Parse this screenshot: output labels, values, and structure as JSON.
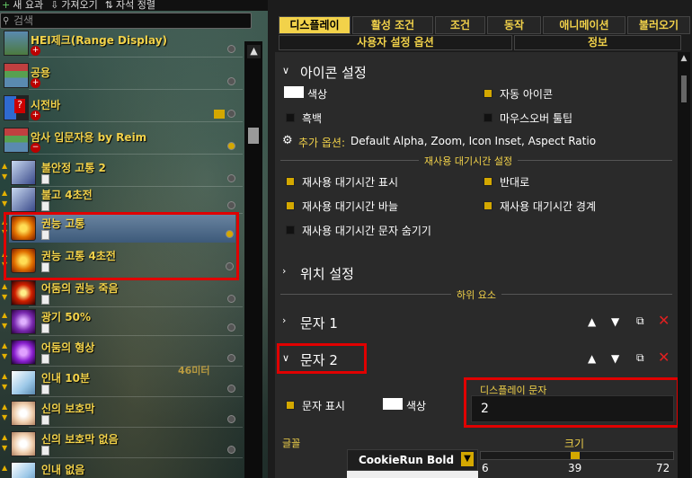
{
  "toolbar": {
    "new_label": "새 요과",
    "import_label": "가져오기",
    "sort_label": "자석 정렬"
  },
  "search": {
    "placeholder": "검색"
  },
  "list": [
    {
      "name": "HEI제크(Range Display)",
      "kind": "group"
    },
    {
      "name": "공용",
      "kind": "group"
    },
    {
      "name": "시전바",
      "kind": "group"
    },
    {
      "name": "암사 입문자용 by Reim",
      "kind": "group"
    },
    {
      "name": "불안정 고통 2",
      "kind": "aura"
    },
    {
      "name": "불고 4초전",
      "kind": "aura"
    },
    {
      "name": "권능 고통",
      "kind": "aura"
    },
    {
      "name": "권능 고통 4초전",
      "kind": "aura"
    },
    {
      "name": "어둠의 권능 죽음",
      "kind": "aura"
    },
    {
      "name": "광기 50%",
      "kind": "aura"
    },
    {
      "name": "어둠의 형상",
      "kind": "aura"
    },
    {
      "name": "인내 10분",
      "kind": "aura"
    },
    {
      "name": "신의 보호막",
      "kind": "aura"
    },
    {
      "name": "신의 보호막 없음",
      "kind": "aura"
    },
    {
      "name": "인내 없음",
      "kind": "aura"
    }
  ],
  "world_text": "46미터",
  "tabs": [
    "디스플레이",
    "활성 조건",
    "조건",
    "동작",
    "애니메이션",
    "불러오기"
  ],
  "subtabs": [
    "사용자 설정 옵션",
    "정보"
  ],
  "icon_section": {
    "title": "아이콘 설정",
    "color_label": "색상",
    "auto_icon_label": "자동 아이콘",
    "desaturate_label": "흑백",
    "mouseover_label": "마우스오버 툴팁",
    "extra_options_label": "추가 옵션:",
    "extra_options_value": "Default Alpha, Zoom, Icon Inset, Aspect Ratio"
  },
  "cooldown_section": {
    "title": "재사용 대기시간 설정",
    "show_label": "재사용 대기시간 표시",
    "reverse_label": "반대로",
    "swipe_label": "재사용 대기시간 바늘",
    "edge_label": "재사용 대기시간 경계",
    "hide_text_label": "재사용 대기시간 문자 숨기기"
  },
  "position_section": {
    "title": "위치 설정"
  },
  "subelements_label": "하위 요소",
  "text1": {
    "title": "문자 1"
  },
  "text2": {
    "title": "문자 2",
    "show_label": "문자 표시",
    "color_label": "색상",
    "display_text_label": "디스플레이 문자",
    "display_text_value": "2",
    "font_label": "글꼴",
    "font_value": "CookieRun Bold",
    "size_label": "크기",
    "size_min": "6",
    "size_value": "39",
    "size_max": "72"
  },
  "colors": {
    "accent": "#f2d24a",
    "highlight": "#e00000",
    "checkbox_on": "#d4a800"
  }
}
